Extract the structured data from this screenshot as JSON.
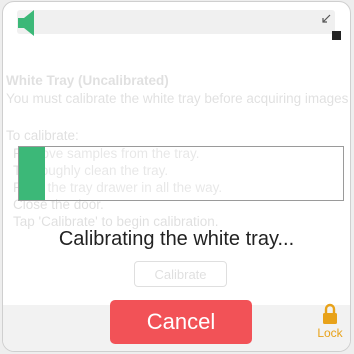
{
  "header": {
    "speaker_icon": "speaker-icon",
    "collapse_icon": "collapse-arrows-icon"
  },
  "background_panel": {
    "title": "White Tray (Uncalibrated)",
    "message": "You must calibrate the white tray before acquiring images",
    "to_calibrate": "To calibrate:",
    "steps": [
      "Remove samples from the tray.",
      "Thoroughly clean the tray.",
      "Push the tray drawer in all the way.",
      "Close the door.",
      "Tap 'Calibrate' to begin calibration."
    ],
    "calibrate_label": "Calibrate"
  },
  "progress": {
    "value": 0.08,
    "status_text": "Calibrating the white tray..."
  },
  "footer": {
    "cancel_label": "Cancel",
    "lock_label": "Lock",
    "lock_icon": "lock-icon"
  },
  "colors": {
    "accent_green": "#3cb878",
    "cancel_red": "#f25257",
    "lock_amber": "#e8a21a"
  }
}
